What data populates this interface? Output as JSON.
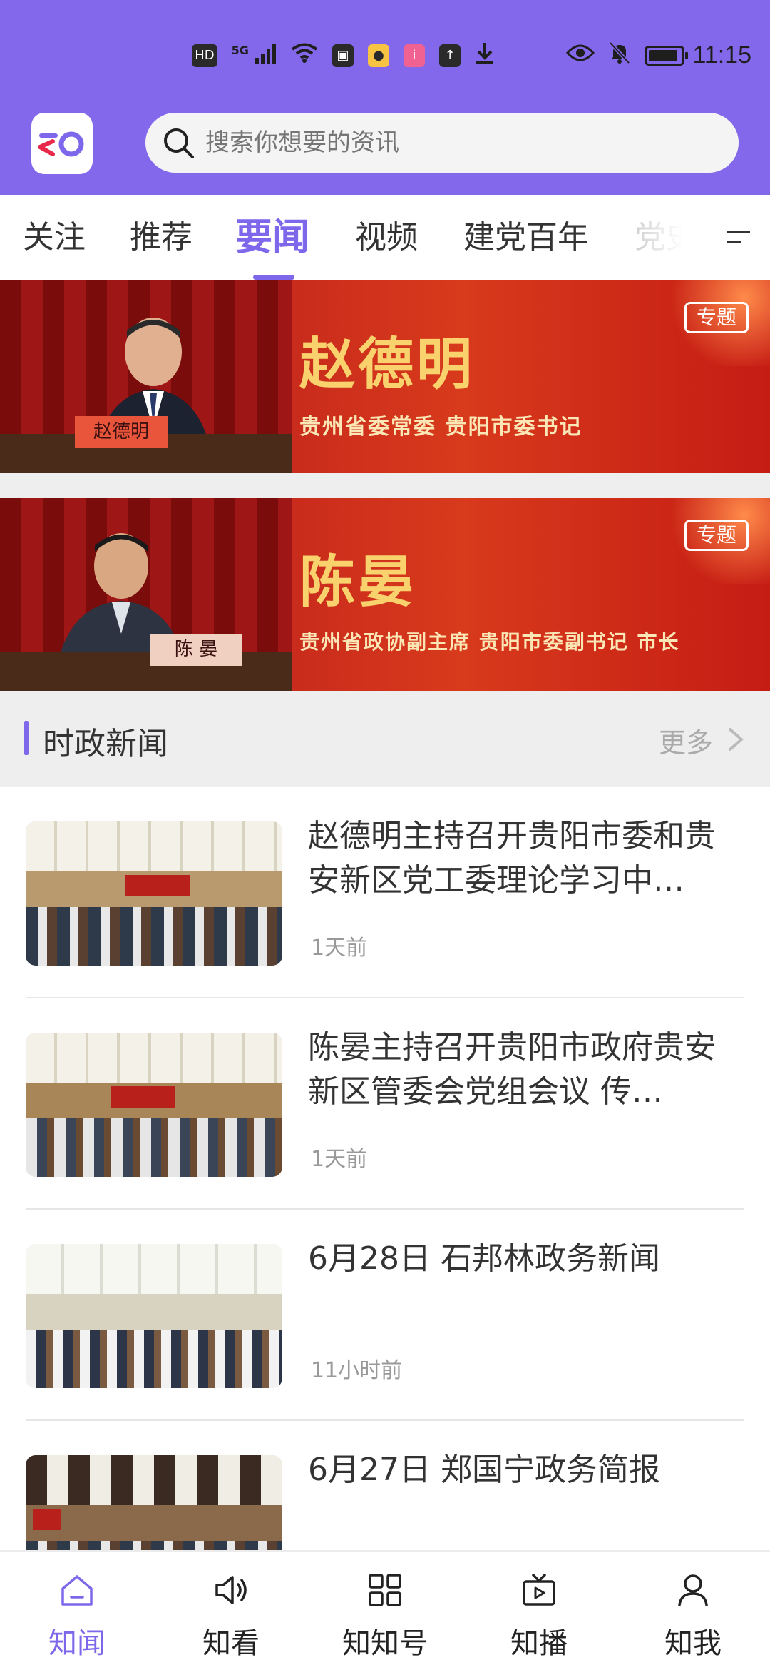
{
  "status_bar": {
    "time": "11:15",
    "hd_label": "HD",
    "signal_label": "5G"
  },
  "header": {
    "search_placeholder": "搜索你想要的资讯"
  },
  "tabs": [
    {
      "label": "关注"
    },
    {
      "label": "推荐"
    },
    {
      "label": "要闻"
    },
    {
      "label": "视频"
    },
    {
      "label": "建党百年"
    },
    {
      "label": "党史"
    }
  ],
  "active_tab": "要闻",
  "banners": [
    {
      "name": "赵德明",
      "title": "贵州省委常委 贵阳市委书记",
      "nameplate": "赵德明",
      "badge": "专题"
    },
    {
      "name": "陈晏",
      "title": "贵州省政协副主席 贵阳市委副书记 市长",
      "nameplate": "陈 晏",
      "badge": "专题"
    }
  ],
  "section": {
    "title": "时政新闻",
    "more": "更多"
  },
  "news": [
    {
      "title": "赵德明主持召开贵阳市委和贵安新区党工委理论学习中…",
      "time": "1天前"
    },
    {
      "title": "陈晏主持召开贵阳市政府贵安新区管委会党组会议  传…",
      "time": "1天前"
    },
    {
      "title": "6月28日  石邦林政务新闻",
      "time": "11小时前"
    },
    {
      "title": "6月27日  郑国宁政务简报",
      "time": ""
    }
  ],
  "bottom_nav": [
    {
      "label": "知闻",
      "icon": "home-icon"
    },
    {
      "label": "知看",
      "icon": "speaker-icon"
    },
    {
      "label": "知知号",
      "icon": "grid-icon"
    },
    {
      "label": "知播",
      "icon": "tv-play-icon"
    },
    {
      "label": "知我",
      "icon": "user-icon"
    }
  ],
  "colors": {
    "header_bg": "#8468ec",
    "accent": "#7e67eb"
  }
}
